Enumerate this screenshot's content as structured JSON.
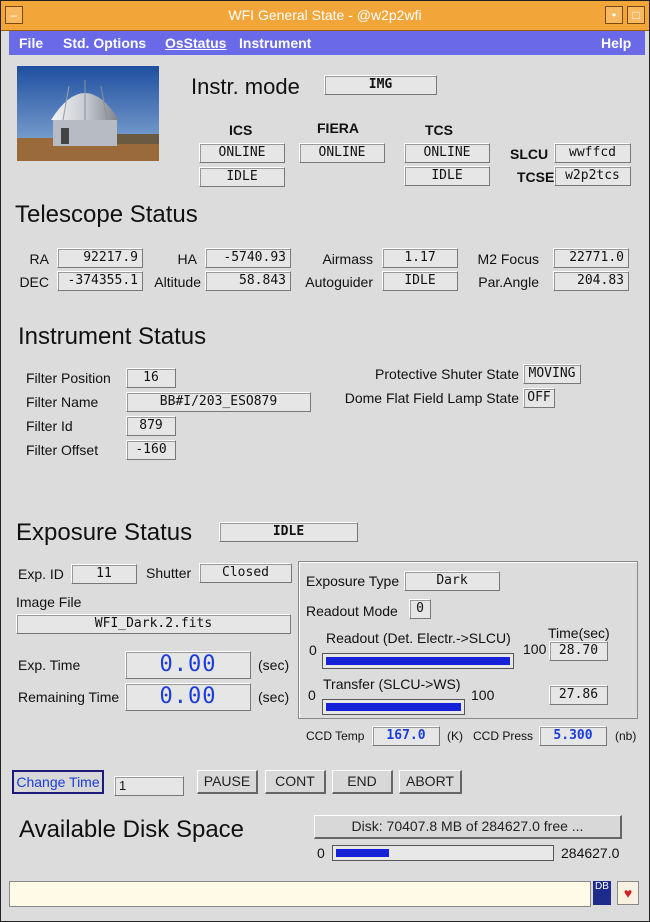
{
  "window": {
    "title": "WFI General State - @w2p2wfi"
  },
  "menu": {
    "file": "File",
    "std_options": "Std. Options",
    "os_status": "OsStatus",
    "instrument": "Instrument",
    "help": "Help"
  },
  "header": {
    "instr_mode_label": "Instr. mode",
    "instr_mode_value": "IMG",
    "ics_label": "ICS",
    "fiera_label": "FIERA",
    "tcs_label": "TCS",
    "ics_state": "ONLINE",
    "ics_sub": "IDLE",
    "fiera_state": "ONLINE",
    "tcs_state": "ONLINE",
    "tcs_sub": "IDLE",
    "slcu_label": "SLCU",
    "slcu_value": "wwffcd",
    "tcse_label": "TCSE",
    "tcse_value": "w2p2tcs"
  },
  "telescope": {
    "title": "Telescope Status",
    "ra_label": "RA",
    "ra": "92217.9",
    "dec_label": "DEC",
    "dec": "-374355.1",
    "ha_label": "HA",
    "ha": "-5740.93",
    "alt_label": "Altitude",
    "alt": "58.843",
    "airmass_label": "Airmass",
    "airmass": "1.17",
    "autoguider_label": "Autoguider",
    "autoguider": "IDLE",
    "m2_label": "M2 Focus",
    "m2": "22771.0",
    "parangle_label": "Par.Angle",
    "parangle": "204.83"
  },
  "instrument": {
    "title": "Instrument Status",
    "filter_pos_label": "Filter Position",
    "filter_pos": "16",
    "filter_name_label": "Filter Name",
    "filter_name": "BB#I/203_ESO879",
    "filter_id_label": "Filter Id",
    "filter_id": "879",
    "filter_offset_label": "Filter Offset",
    "filter_offset": "-160",
    "shutter_state_label": "Protective Shuter State",
    "shutter_state": "MOVING",
    "lamp_label": "Dome Flat Field Lamp State",
    "lamp": "OFF"
  },
  "exposure": {
    "title": "Exposure Status",
    "state": "IDLE",
    "exp_id_label": "Exp. ID",
    "exp_id": "11",
    "shutter_label": "Shutter",
    "shutter": "Closed",
    "image_file_label": "Image File",
    "image_file": "WFI_Dark.2.fits",
    "exp_time_label": "Exp. Time",
    "exp_time": "0.00",
    "exp_time_unit": "(sec)",
    "remaining_label": "Remaining Time",
    "remaining": "0.00",
    "remaining_unit": "(sec)",
    "exp_type_label": "Exposure Type",
    "exp_type": "Dark",
    "readout_mode_label": "Readout Mode",
    "readout_mode": "0",
    "readout_label": "Readout (Det. Electr.->SLCU)",
    "readout_min": "0",
    "readout_max": "100",
    "readout_progress": 1.0,
    "time_label": "Time(sec)",
    "readout_time": "28.70",
    "transfer_label": "Transfer (SLCU->WS)",
    "transfer_min": "0",
    "transfer_max": "100",
    "transfer_progress": 1.0,
    "transfer_time": "27.86",
    "ccd_temp_label": "CCD Temp",
    "ccd_temp": "167.0",
    "ccd_temp_unit": "(K)",
    "ccd_press_label": "CCD Press",
    "ccd_press": "5.300",
    "ccd_press_unit": "(nb)"
  },
  "controls": {
    "change_time": "Change Time",
    "time_input": "1",
    "pause": "PAUSE",
    "cont": "CONT",
    "end": "END",
    "abort": "ABORT"
  },
  "disk": {
    "title": "Available Disk Space",
    "summary": "Disk: 70407.8 MB of 284627.0 free ...",
    "min": "0",
    "max": "284627.0",
    "free_fraction": 0.247
  },
  "statusbar": {
    "text": ""
  },
  "colors": {
    "titlebar": "#f2a63a",
    "menubar": "#6a6ae8",
    "accent_blue": "#1522d8"
  }
}
